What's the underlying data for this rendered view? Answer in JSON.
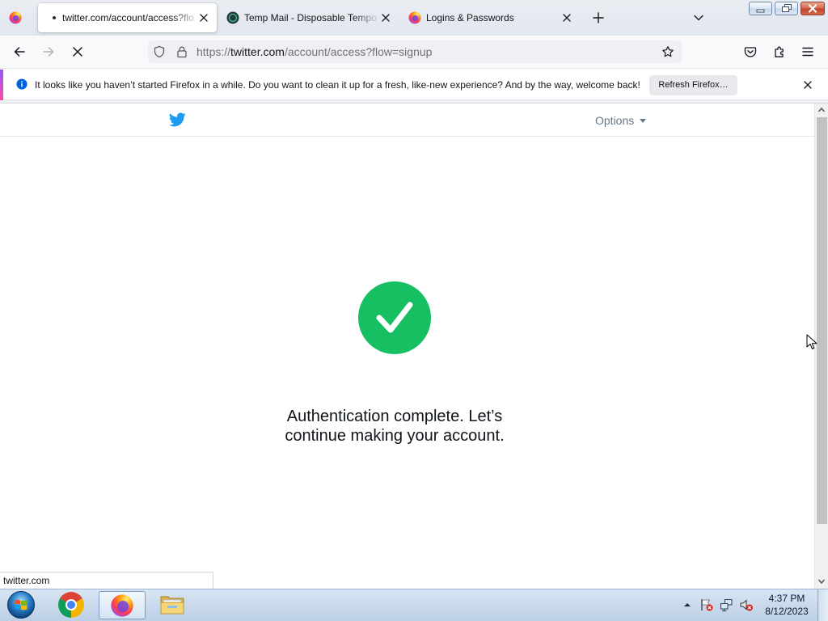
{
  "browser": {
    "tabs": [
      {
        "title": "twitter.com/account/access?flo",
        "active": true,
        "loading": true
      },
      {
        "title": "Temp Mail - Disposable Tempo",
        "active": false
      },
      {
        "title": "Logins & Passwords",
        "active": false
      }
    ],
    "url": {
      "scheme": "https://",
      "host": "twitter.com",
      "path": "/account/access?flow=signup"
    },
    "notification": {
      "message": "It looks like you haven’t started Firefox in a while. Do you want to clean it up for a fresh, like-new experience? And by the way, welcome back!",
      "button_label": "Refresh Firefox…"
    },
    "status_text": "twitter.com",
    "toolbar_icons": [
      "back-icon",
      "forward-icon",
      "stop-icon",
      "tracking-shield-icon",
      "lock-icon",
      "bookmark-star-icon",
      "pocket-icon",
      "extensions-icon",
      "menu-icon"
    ]
  },
  "page": {
    "options_label": "Options",
    "message": "Authentication complete. Let’s continue making your account.",
    "status_icon": "success-check-icon"
  },
  "taskbar": {
    "apps": [
      "start-orb-icon",
      "chrome-icon",
      "firefox-icon",
      "file-explorer-icon"
    ],
    "active_app": "firefox-icon",
    "tray_icons": [
      "show-hidden-icons-icon",
      "action-center-flag-icon",
      "network-icon",
      "volume-muted-icon"
    ],
    "time": "4:37 PM",
    "date": "8/12/2023"
  },
  "colors": {
    "twitter_blue": "#1d9bf0",
    "success_green": "#17bf63",
    "info_blue": "#0060df",
    "options_gray": "#657786"
  }
}
